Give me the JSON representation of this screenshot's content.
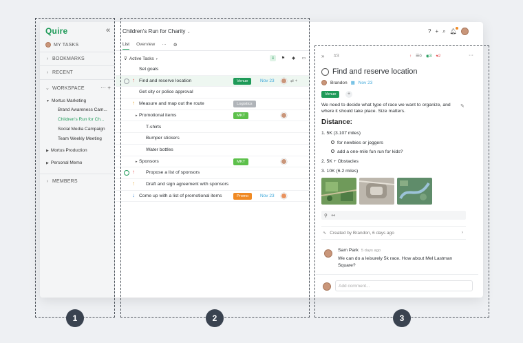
{
  "sidebar": {
    "logo": "Quire",
    "my_tasks": "MY TASKS",
    "bookmarks": "BOOKMARKS",
    "recent": "RECENT",
    "workspace": "WORKSPACE",
    "workspace_tools": "··· +",
    "tree": [
      {
        "label": "Mortus Marketing",
        "level": 0
      },
      {
        "label": "Brand Awareness Cam...",
        "level": 1
      },
      {
        "label": "Children's Run for Ch...",
        "level": 1,
        "active": true
      },
      {
        "label": "Social Media Campaign",
        "level": 1
      },
      {
        "label": "Team Weekly Meeting",
        "level": 1
      },
      {
        "label": "Mortus Production",
        "level": 0
      },
      {
        "label": "Personal Memo",
        "level": 0
      }
    ],
    "members": "MEMBERS"
  },
  "list": {
    "project_title": "Children's Run for Charity",
    "tabs": [
      "List",
      "Overview",
      "···"
    ],
    "filter_label": "Active Tasks",
    "tasks": [
      {
        "name": "Set goals",
        "indent": 0
      },
      {
        "name": "Find and reserve location",
        "indent": 0,
        "prio": "up-r",
        "tag": "Venue",
        "tag_color": "#1e9a58",
        "date": "Nov 23",
        "assignee": true,
        "selected": true
      },
      {
        "name": "Get city or police approval",
        "indent": 0
      },
      {
        "name": "Measure and map out the route",
        "indent": 0,
        "prio": "up-y",
        "tag": "Logistics",
        "tag_color": "#b0b4b9"
      },
      {
        "name": "Promotional items",
        "indent": 0,
        "parent": true,
        "tag": "MKT",
        "tag_color": "#5cc04a",
        "assignee": true
      },
      {
        "name": "T-shirts",
        "indent": 1
      },
      {
        "name": "Bumper stickers",
        "indent": 1
      },
      {
        "name": "Water bottles",
        "indent": 1
      },
      {
        "name": "Sponsors",
        "indent": 0,
        "parent": true,
        "tag": "MKT",
        "tag_color": "#5cc04a",
        "assignee": true
      },
      {
        "name": "Propose a list of sponsors",
        "indent": 1,
        "prio": "up-r",
        "green_check": true
      },
      {
        "name": "Draft and sign agreement with sponsors",
        "indent": 1,
        "prio": "up-y"
      },
      {
        "name": "Come up with a list of promotional items",
        "indent": 0,
        "prio": "dn-b",
        "tag": "Promo",
        "tag_color": "#f08a24",
        "date": "Nov 23",
        "assignee_alt": true
      }
    ]
  },
  "details": {
    "number": "#3",
    "stats": {
      "up": "↑",
      "subtasks": "0",
      "watchers": "3",
      "likes": "2"
    },
    "title": "Find and reserve location",
    "assignee": "Brandon",
    "due": "Nov 23",
    "tag": "Venue",
    "description": "We need to decide what type of race we want to organize, and where it should take place. Size matters.",
    "heading": "Distance:",
    "items": [
      "1. 5K (3.107 miles)",
      "for newbies or joggers",
      "add a one-mile fun run for kids?",
      "2. 5K + Obstacles",
      "3. 10K (6.2 miles)"
    ],
    "created": "Created by Brandon, 6 days ago",
    "comment": {
      "author": "Sam Park",
      "time": "5 days ago",
      "text": "We can do a leisurely 5k race. How about Mel Lastman Square?"
    },
    "add_comment_placeholder": "Add comment..."
  },
  "callouts": [
    "1",
    "2",
    "3"
  ]
}
